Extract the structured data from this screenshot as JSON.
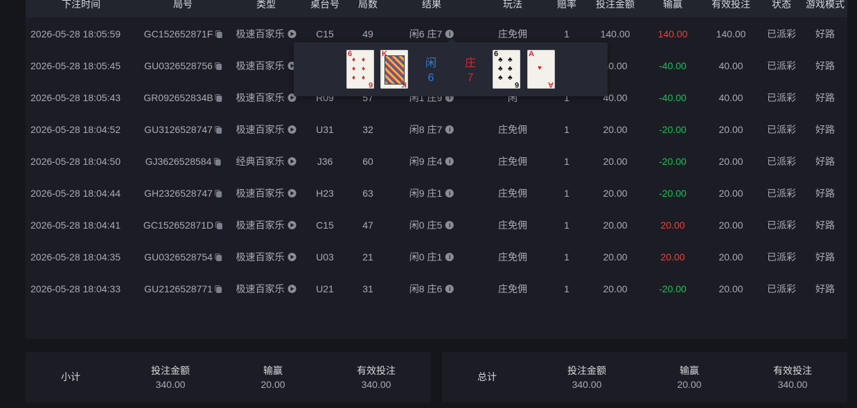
{
  "headers": {
    "bet_time": "下注时间",
    "round_no": "局号",
    "type": "类型",
    "table_no": "桌台号",
    "rounds": "局数",
    "result": "结果",
    "play": "玩法",
    "odds": "赔率",
    "bet_amount": "投注金额",
    "win_loss": "输赢",
    "valid_bet": "有效投注",
    "status": "状态",
    "game_mode": "游戏模式"
  },
  "rows": [
    {
      "time": "2026-05-28 18:05:59",
      "round": "GC152652871F",
      "type": "极速百家乐",
      "table": "C15",
      "rounds": "49",
      "result": "闲6 庄7",
      "play": "庄免佣",
      "odds": "1",
      "bet": "140.00",
      "winloss": "140.00",
      "wl_sign": "pos",
      "valid": "140.00",
      "status": "已派彩",
      "mode": "好路"
    },
    {
      "time": "2026-05-28 18:05:45",
      "round": "GU0326528756",
      "type": "极速百家乐",
      "table": "",
      "rounds": "",
      "result": "",
      "play": "",
      "odds": "",
      "bet": "40.00",
      "winloss": "-40.00",
      "wl_sign": "neg",
      "valid": "40.00",
      "status": "已派彩",
      "mode": "好路"
    },
    {
      "time": "2026-05-28 18:05:43",
      "round": "GR092652834B",
      "type": "极速百家乐",
      "table": "R09",
      "rounds": "57",
      "result": "闲1 庄9",
      "play": "闲",
      "odds": "1",
      "bet": "40.00",
      "winloss": "-40.00",
      "wl_sign": "neg",
      "valid": "40.00",
      "status": "已派彩",
      "mode": "好路"
    },
    {
      "time": "2026-05-28 18:04:52",
      "round": "GU3126528747",
      "type": "极速百家乐",
      "table": "U31",
      "rounds": "32",
      "result": "闲8 庄7",
      "play": "庄免佣",
      "odds": "1",
      "bet": "20.00",
      "winloss": "-20.00",
      "wl_sign": "neg",
      "valid": "20.00",
      "status": "已派彩",
      "mode": "好路"
    },
    {
      "time": "2026-05-28 18:04:50",
      "round": "GJ3626528584",
      "type": "经典百家乐",
      "table": "J36",
      "rounds": "60",
      "result": "闲9 庄4",
      "play": "庄免佣",
      "odds": "1",
      "bet": "20.00",
      "winloss": "-20.00",
      "wl_sign": "neg",
      "valid": "20.00",
      "status": "已派彩",
      "mode": "好路"
    },
    {
      "time": "2026-05-28 18:04:44",
      "round": "GH2326528747",
      "type": "极速百家乐",
      "table": "H23",
      "rounds": "63",
      "result": "闲9 庄1",
      "play": "庄免佣",
      "odds": "1",
      "bet": "20.00",
      "winloss": "-20.00",
      "wl_sign": "neg",
      "valid": "20.00",
      "status": "已派彩",
      "mode": "好路"
    },
    {
      "time": "2026-05-28 18:04:41",
      "round": "GC152652871D",
      "type": "极速百家乐",
      "table": "C15",
      "rounds": "47",
      "result": "闲0 庄5",
      "play": "庄免佣",
      "odds": "1",
      "bet": "20.00",
      "winloss": "20.00",
      "wl_sign": "pos",
      "valid": "20.00",
      "status": "已派彩",
      "mode": "好路"
    },
    {
      "time": "2026-05-28 18:04:35",
      "round": "GU0326528754",
      "type": "极速百家乐",
      "table": "U03",
      "rounds": "21",
      "result": "闲0 庄1",
      "play": "庄免佣",
      "odds": "1",
      "bet": "20.00",
      "winloss": "20.00",
      "wl_sign": "pos",
      "valid": "20.00",
      "status": "已派彩",
      "mode": "好路"
    },
    {
      "time": "2026-05-28 18:04:33",
      "round": "GU2126528771",
      "type": "极速百家乐",
      "table": "U21",
      "rounds": "31",
      "result": "闲8 庄6",
      "play": "庄免佣",
      "odds": "1",
      "bet": "20.00",
      "winloss": "-20.00",
      "wl_sign": "neg",
      "valid": "20.00",
      "status": "已派彩",
      "mode": "好路"
    }
  ],
  "tooltip": {
    "player_label": "闲",
    "player_score": "6",
    "banker_label": "庄",
    "banker_score": "7",
    "player_cards": [
      {
        "rank": "6",
        "suit": "♦",
        "color": "red"
      },
      {
        "rank": "K",
        "suit": "♥",
        "color": "red"
      }
    ],
    "banker_cards": [
      {
        "rank": "6",
        "suit": "♣",
        "color": "black"
      },
      {
        "rank": "A",
        "suit": "♥",
        "color": "red"
      }
    ],
    "colors": {
      "player": "#2f7fe0",
      "banker": "#e0242a"
    }
  },
  "subtotal": {
    "title": "小计",
    "bet_label": "投注金额",
    "bet_value": "340.00",
    "wl_label": "输赢",
    "wl_value": "20.00",
    "valid_label": "有效投注",
    "valid_value": "340.00"
  },
  "total": {
    "title": "总计",
    "bet_label": "投注金额",
    "bet_value": "340.00",
    "wl_label": "输赢",
    "wl_value": "20.00",
    "valid_label": "有效投注",
    "valid_value": "340.00"
  },
  "colors": {
    "win": "#e8423f",
    "loss": "#1fbf5f"
  }
}
